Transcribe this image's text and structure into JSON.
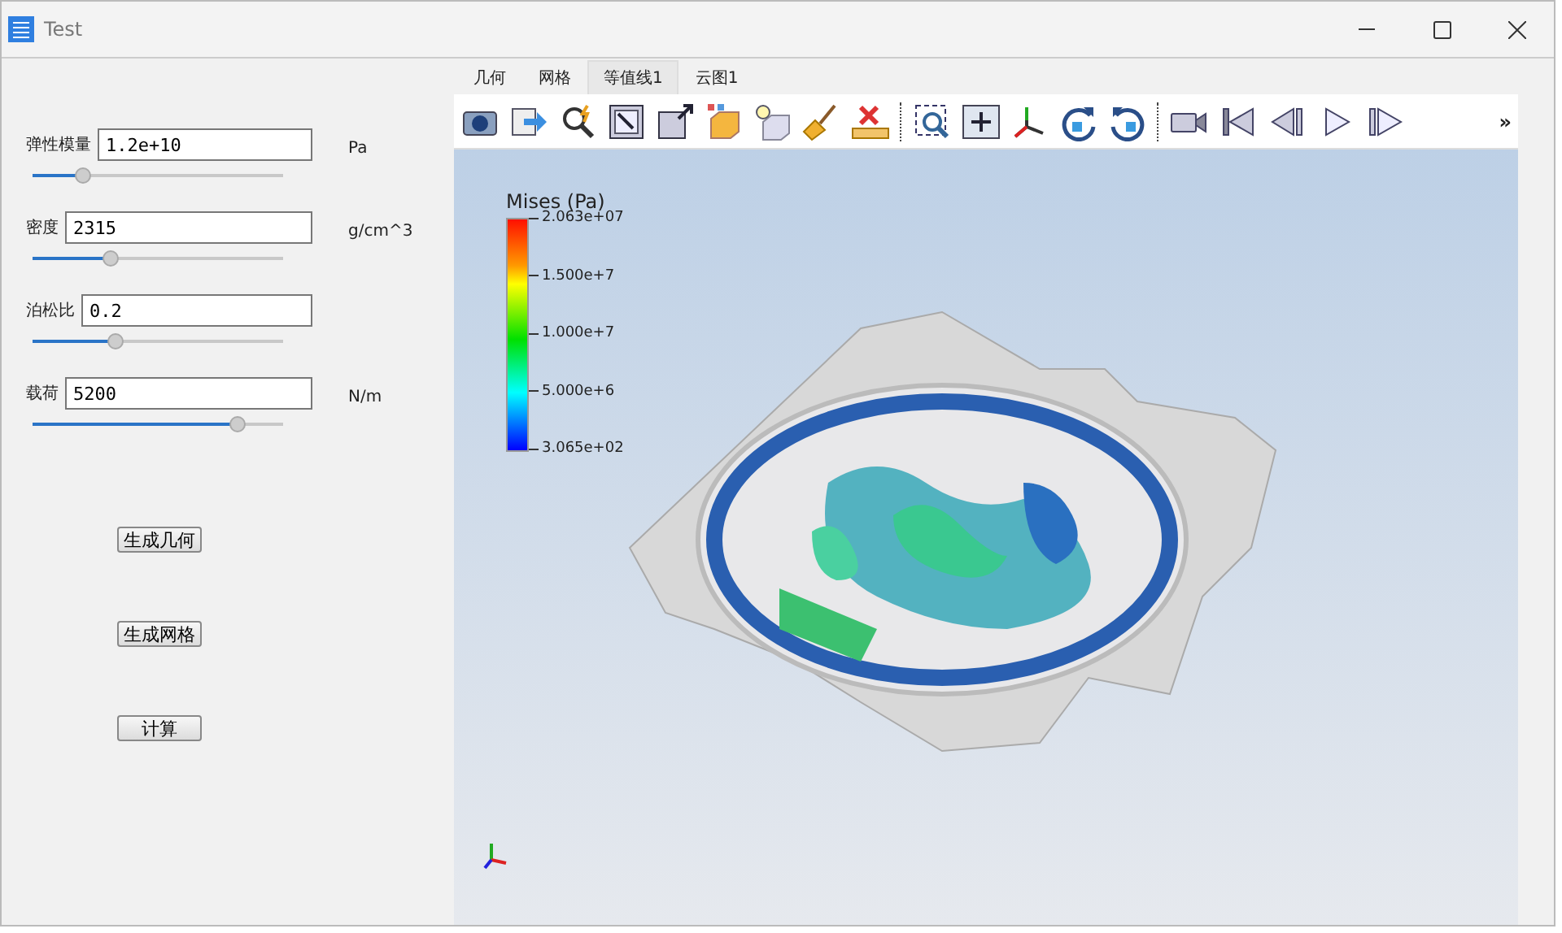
{
  "window": {
    "title": "Test"
  },
  "parameters": [
    {
      "label": "弹性模量",
      "value": "1.2e+10",
      "unit": "Pa",
      "level": 0.2
    },
    {
      "label": "密度",
      "value": "2315",
      "unit": "g/cm^3",
      "level": 0.31
    },
    {
      "label": "泊松比",
      "value": "0.2",
      "level": 0.33
    },
    {
      "label": "载荷",
      "value": "5200",
      "unit": "N/m",
      "level": 0.82
    }
  ],
  "buttons": [
    "生成几何",
    "生成网格",
    "计算"
  ],
  "tabs": [
    {
      "label": "几何",
      "selected": false
    },
    {
      "label": "网格",
      "selected": false
    },
    {
      "label": "等值线1",
      "selected": true
    },
    {
      "label": "云图1",
      "selected": false
    }
  ],
  "toolbar": {
    "overflow": "»"
  },
  "legend": {
    "title": "Mises (Pa)",
    "ticks": [
      "2.063e+07",
      "1.500e+7",
      "1.000e+7",
      "5.000e+6",
      "3.065e+02"
    ]
  }
}
